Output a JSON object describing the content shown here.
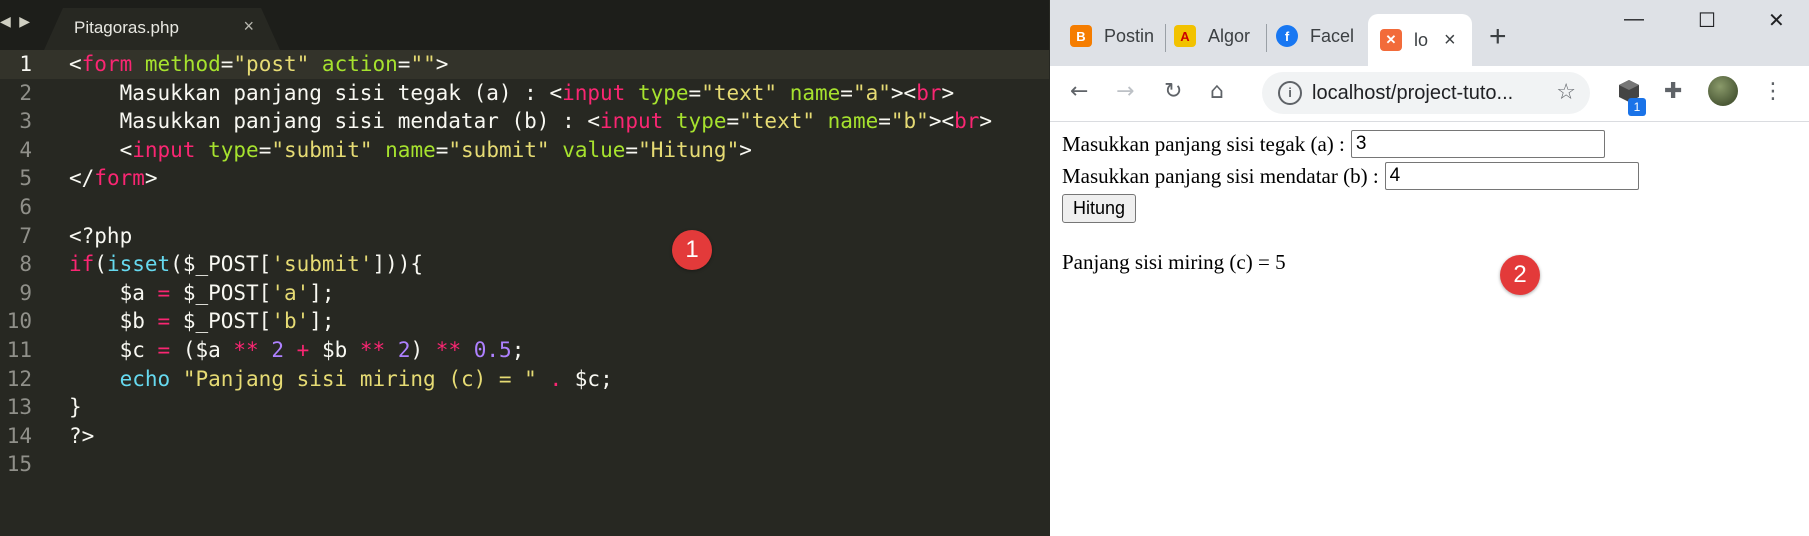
{
  "editor": {
    "nav_arrows": "◀ ▶",
    "tab": {
      "filename": "Pitagoras.php",
      "close": "×"
    },
    "line_numbers": [
      "1",
      "2",
      "3",
      "4",
      "5",
      "6",
      "7",
      "8",
      "9",
      "10",
      "11",
      "12",
      "13",
      "14",
      "15"
    ],
    "lines": [
      [
        [
          "t-punct",
          "<"
        ],
        [
          "t-tag",
          "form"
        ],
        [
          "t-plain",
          " "
        ],
        [
          "t-attr",
          "method"
        ],
        [
          "t-punct",
          "="
        ],
        [
          "t-str",
          "\"post\""
        ],
        [
          "t-plain",
          " "
        ],
        [
          "t-attr",
          "action"
        ],
        [
          "t-punct",
          "="
        ],
        [
          "t-str",
          "\"\""
        ],
        [
          "t-punct",
          ">"
        ]
      ],
      [
        [
          "t-plain",
          "    Masukkan panjang sisi tegak (a) : "
        ],
        [
          "t-punct",
          "<"
        ],
        [
          "t-tag",
          "input"
        ],
        [
          "t-plain",
          " "
        ],
        [
          "t-attr",
          "type"
        ],
        [
          "t-punct",
          "="
        ],
        [
          "t-str",
          "\"text\""
        ],
        [
          "t-plain",
          " "
        ],
        [
          "t-attr",
          "name"
        ],
        [
          "t-punct",
          "="
        ],
        [
          "t-str",
          "\"a\""
        ],
        [
          "t-punct",
          "><"
        ],
        [
          "t-tag",
          "br"
        ],
        [
          "t-punct",
          ">"
        ]
      ],
      [
        [
          "t-plain",
          "    Masukkan panjang sisi mendatar (b) : "
        ],
        [
          "t-punct",
          "<"
        ],
        [
          "t-tag",
          "input"
        ],
        [
          "t-plain",
          " "
        ],
        [
          "t-attr",
          "type"
        ],
        [
          "t-punct",
          "="
        ],
        [
          "t-str",
          "\"text\""
        ],
        [
          "t-plain",
          " "
        ],
        [
          "t-attr",
          "name"
        ],
        [
          "t-punct",
          "="
        ],
        [
          "t-str",
          "\"b\""
        ],
        [
          "t-punct",
          "><"
        ],
        [
          "t-tag",
          "br"
        ],
        [
          "t-punct",
          ">"
        ]
      ],
      [
        [
          "t-plain",
          "    "
        ],
        [
          "t-punct",
          "<"
        ],
        [
          "t-tag",
          "input"
        ],
        [
          "t-plain",
          " "
        ],
        [
          "t-attr",
          "type"
        ],
        [
          "t-punct",
          "="
        ],
        [
          "t-str",
          "\"submit\""
        ],
        [
          "t-plain",
          " "
        ],
        [
          "t-attr",
          "name"
        ],
        [
          "t-punct",
          "="
        ],
        [
          "t-str",
          "\"submit\""
        ],
        [
          "t-plain",
          " "
        ],
        [
          "t-attr",
          "value"
        ],
        [
          "t-punct",
          "="
        ],
        [
          "t-str",
          "\"Hitung\""
        ],
        [
          "t-punct",
          ">"
        ]
      ],
      [
        [
          "t-punct",
          "</"
        ],
        [
          "t-tag",
          "form"
        ],
        [
          "t-punct",
          ">"
        ]
      ],
      [],
      [
        [
          "t-plain",
          "<?php"
        ]
      ],
      [
        [
          "t-kw",
          "if"
        ],
        [
          "t-plain",
          "("
        ],
        [
          "t-fn",
          "isset"
        ],
        [
          "t-plain",
          "($_POST["
        ],
        [
          "t-str",
          "'submit'"
        ],
        [
          "t-plain",
          "])){"
        ]
      ],
      [
        [
          "t-plain",
          "    $a "
        ],
        [
          "t-op",
          "="
        ],
        [
          "t-plain",
          " $_POST["
        ],
        [
          "t-str",
          "'a'"
        ],
        [
          "t-plain",
          "];"
        ]
      ],
      [
        [
          "t-plain",
          "    $b "
        ],
        [
          "t-op",
          "="
        ],
        [
          "t-plain",
          " $_POST["
        ],
        [
          "t-str",
          "'b'"
        ],
        [
          "t-plain",
          "];"
        ]
      ],
      [
        [
          "t-plain",
          "    $c "
        ],
        [
          "t-op",
          "="
        ],
        [
          "t-plain",
          " ($a "
        ],
        [
          "t-op",
          "**"
        ],
        [
          "t-plain",
          " "
        ],
        [
          "t-num",
          "2"
        ],
        [
          "t-plain",
          " "
        ],
        [
          "t-op",
          "+"
        ],
        [
          "t-plain",
          " $b "
        ],
        [
          "t-op",
          "**"
        ],
        [
          "t-plain",
          " "
        ],
        [
          "t-num",
          "2"
        ],
        [
          "t-plain",
          ") "
        ],
        [
          "t-op",
          "**"
        ],
        [
          "t-plain",
          " "
        ],
        [
          "t-num",
          "0.5"
        ],
        [
          "t-plain",
          ";"
        ]
      ],
      [
        [
          "t-plain",
          "    "
        ],
        [
          "t-fn",
          "echo"
        ],
        [
          "t-plain",
          " "
        ],
        [
          "t-str",
          "\"Panjang sisi miring (c) = \""
        ],
        [
          "t-plain",
          " "
        ],
        [
          "t-op",
          "."
        ],
        [
          "t-plain",
          " $c;"
        ]
      ],
      [
        [
          "t-plain",
          "}"
        ]
      ],
      [
        [
          "t-plain",
          "?>"
        ]
      ],
      []
    ],
    "badge": "1"
  },
  "browser": {
    "tabs": [
      {
        "label": "Postin",
        "favicon": "B",
        "color": "#f57d00"
      },
      {
        "label": "Algor",
        "favicon": "A",
        "color": "#f2c200"
      },
      {
        "label": "Facel",
        "favicon": "f",
        "color": "#1877f2"
      },
      {
        "label": "lo",
        "favicon": "✕",
        "color": "#f26b3a",
        "active": true,
        "close": "×"
      }
    ],
    "new_tab": "+",
    "window_controls": {
      "minimize": "—",
      "maximize": "☐",
      "close": "✕"
    },
    "toolbar": {
      "back": "←",
      "forward": "→",
      "reload": "↻",
      "home": "⌂",
      "info": "i",
      "url": "localhost/project-tuto...",
      "star": "☆",
      "ext_badge": "1",
      "puzzle": "✚",
      "menu": "⋮"
    },
    "page": {
      "label_a": "Masukkan panjang sisi tegak (a) :",
      "value_a": "3",
      "label_b": "Masukkan panjang sisi mendatar (b) :",
      "value_b": "4",
      "submit": "Hitung",
      "result": "Panjang sisi miring (c) = 5"
    },
    "badge": "2"
  }
}
